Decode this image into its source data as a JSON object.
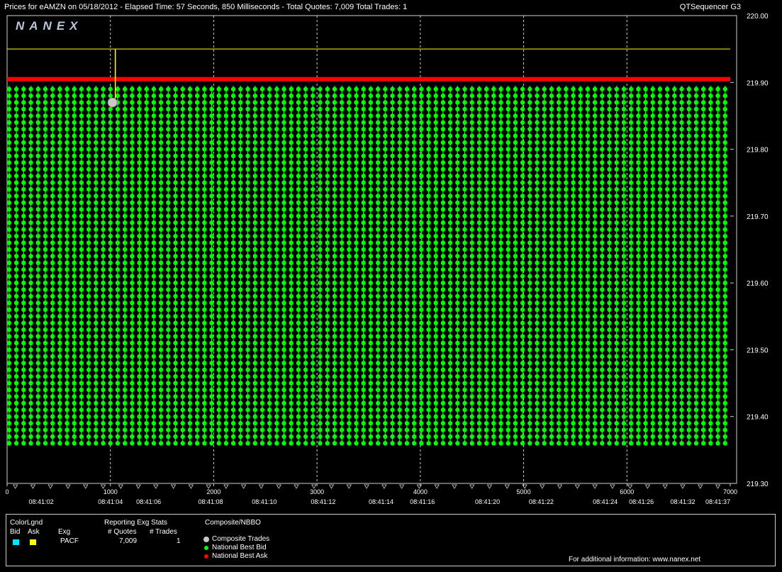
{
  "title": {
    "left": "Prices for  eAMZN  on  05/18/2012  -  Elapsed Time: 57 Seconds, 850 Milliseconds  -  Total Quotes: 7,009  Total Trades: 1",
    "right": "QTSequencer G3"
  },
  "logo": "NANEX",
  "colors": {
    "bid": "#00e5ff",
    "ask": "#ffff00",
    "nbb": "#00ff00",
    "nbo": "#ff0000",
    "trade": "#c8c8c8",
    "grid": "#cfcfcf",
    "background": "#000000"
  },
  "chart_data": {
    "type": "scatter",
    "xlim": [
      0,
      7000
    ],
    "ylim": [
      219.3,
      220.0
    ],
    "x_ticks": [
      "0",
      "1000",
      "2000",
      "3000",
      "4000",
      "5000",
      "6000",
      "7000"
    ],
    "y_ticks": [
      "220.00",
      "219.90",
      "219.80",
      "219.70",
      "219.60",
      "219.50",
      "219.40",
      "219.30"
    ],
    "time_labels": [
      {
        "x": 330,
        "label": "08:41:02"
      },
      {
        "x": 1000,
        "label": "08:41:04"
      },
      {
        "x": 1370,
        "label": "08:41:06"
      },
      {
        "x": 1970,
        "label": "08:41:08"
      },
      {
        "x": 2490,
        "label": "08:41:10"
      },
      {
        "x": 3060,
        "label": "08:41:12"
      },
      {
        "x": 3620,
        "label": "08:41:14"
      },
      {
        "x": 4020,
        "label": "08:41:16"
      },
      {
        "x": 4650,
        "label": "08:41:20"
      },
      {
        "x": 5170,
        "label": "08:41:22"
      },
      {
        "x": 5790,
        "label": "08:41:24"
      },
      {
        "x": 6140,
        "label": "08:41:26"
      },
      {
        "x": 6540,
        "label": "08:41:32"
      },
      {
        "x": 6880,
        "label": "08:41:37"
      }
    ],
    "series": [
      {
        "name": "National Best Ask",
        "color": "#ff0000",
        "x": [
          0,
          7000
        ],
        "y": [
          219.905,
          219.905
        ]
      },
      {
        "name": "National Best Bid",
        "color": "#00ff00",
        "x_start": 20,
        "x_end": 6980,
        "x_step": 70,
        "y_start": 219.36,
        "y_end": 219.895,
        "y_step": 0.01
      },
      {
        "name": "Composite Trades",
        "color": "#c8c8c8",
        "points": [
          {
            "x": 1020,
            "y": 219.87
          }
        ]
      },
      {
        "name": "Ask",
        "color": "#ffff00",
        "x": [
          0,
          7000
        ],
        "y": [
          219.95,
          219.95
        ]
      }
    ]
  },
  "legend": {
    "colorlgnd": "ColorLgnd",
    "bid": "Bid",
    "ask": "Ask",
    "reporting": "Reporting Exg Stats",
    "exg_header": "Exg",
    "quotes_header": "# Quotes",
    "trades_header": "# Trades",
    "exchange": "PACF",
    "quotes": "7,009",
    "trades": "1",
    "composite_header": "Composite/NBBO",
    "items": [
      "Composite Trades",
      "National Best Bid",
      "National Best Ask"
    ],
    "footer": "For additional information: www.nanex.net"
  }
}
